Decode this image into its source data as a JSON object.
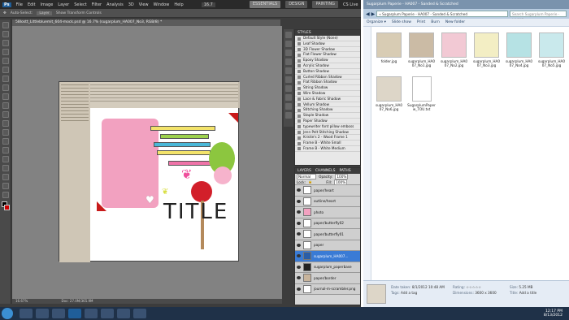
{
  "photoshop": {
    "menu": [
      "File",
      "Edit",
      "Image",
      "Layer",
      "Select",
      "Filter",
      "Analysis",
      "3D",
      "View",
      "Window",
      "Help"
    ],
    "zoom_box": "16.7",
    "workspaces": [
      "ESSENTIALS",
      "DESIGN",
      "PAINTING"
    ],
    "cs_live": "CS Live",
    "options": {
      "auto_select": "Auto-Select:",
      "auto_select_value": "Layer",
      "transform": "Show Transform Controls"
    },
    "doc_tab": "58lostt_Littlebluemit_604-mock.psd @ 16.7% (sugarplum_HA007_No3, RGB/8) *",
    "status_zoom": "16.67%",
    "status_doc": "Doc: 27.0M/365.9M",
    "canvas_title": "TITLE",
    "styles_panel": {
      "tab": "STYLES",
      "items": [
        "Default Style (None)",
        "Leaf Shadow",
        "3D Flower Shadow",
        "Flat Flower Shadow",
        "Epoxy Shadow",
        "Acrylic Shadow",
        "Button Shadow",
        "Curled Ribbon Shadow",
        "Flat Ribbon Shadow",
        "String Shadow",
        "Wire Shadow",
        "Lace & Fabric Shadow",
        "Vellum Shadow",
        "Stitching Shadow",
        "Staple Shadow",
        "Paper Shadow",
        "typewriter font pillow emboss",
        "Jenn Pelt Stitching Shadow",
        "Kristie's 2 - Wood Frame 1",
        "Frame B - White Small",
        "Frame B - White Medium"
      ]
    },
    "layers_panel": {
      "tabs": [
        "LAYERS",
        "CHANNELS",
        "PATHS"
      ],
      "blend": "Normal",
      "opacity_label": "Opacity:",
      "opacity": "100%",
      "fill_label": "Fill:",
      "fill": "100%",
      "lock_label": "Lock:",
      "layers": [
        "paper/heart",
        "outline/heart",
        "photo",
        "paper/butterfly02",
        "paper/butterfly01",
        "paper",
        "sugarplum_HA007...",
        "sugarplum_paperbase",
        "paper/border",
        "journal-m-scrambler.png"
      ]
    }
  },
  "explorer": {
    "title": "Sugarplum Paperie - HA007 - Sanded & Scratched",
    "address": "« Sugarplum Paperie - HA007 - Sanded & Scratched",
    "search_placeholder": "Search Sugarplum Paperie - HA007",
    "commands": [
      "Organize ▾",
      "Slide show",
      "Print",
      "Burn",
      "New folder"
    ],
    "files": [
      {
        "name": "folder.jpg",
        "color": "#d8ccb4"
      },
      {
        "name": "sugarplum_HA007_No1.jpg",
        "color": "#cbbba5"
      },
      {
        "name": "sugarplum_HA007_No2.jpg",
        "color": "#f2c9d4"
      },
      {
        "name": "sugarplum_HA007_No3.jpg",
        "color": "#f3eec4"
      },
      {
        "name": "sugarplum_HA007_No4.jpg",
        "color": "#b6e2e4"
      },
      {
        "name": "sugarplum_HA007_No5.jpg",
        "color": "#c9e9ec"
      },
      {
        "name": "sugarplum_HA007_No6.jpg",
        "color": "#ddd6c8"
      },
      {
        "name": "SugarplumPaperie_TOU.txt",
        "color": "#ffffff"
      }
    ],
    "details": {
      "date_taken_label": "Date taken:",
      "date_taken": "8/1/2012 10:48 AM",
      "tags_label": "Tags:",
      "tags": "Add a tag",
      "rating_label": "Rating:",
      "rating": "☆☆☆☆☆",
      "dimensions_label": "Dimensions:",
      "dimensions": "3600 x 3600",
      "size_label": "Size:",
      "size": "5.25 MB",
      "title_label": "Title:",
      "title": "Add a title"
    }
  },
  "taskbar": {
    "time": "12:17 PM",
    "date": "8/13/2012"
  }
}
